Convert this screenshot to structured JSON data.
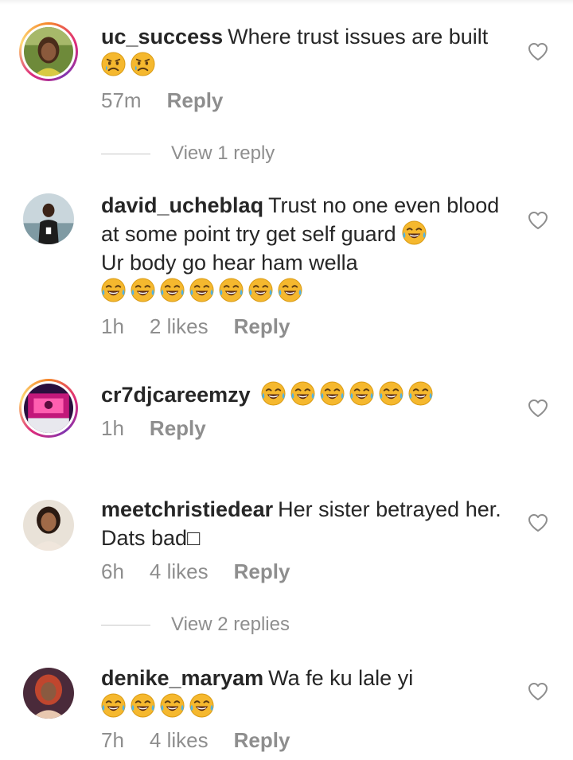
{
  "comments": [
    {
      "username": "uc_success",
      "text": "Where trust issues are built",
      "emojis": [
        "worried",
        "worried"
      ],
      "time": "57m",
      "likes": "",
      "reply_label": "Reply",
      "avatar_ring": true,
      "view_replies": "View 1 reply"
    },
    {
      "username": "david_ucheblaq",
      "text": "Trust no one even blood at some point try get self guard",
      "text_emoji_inline": "tears-of-joy",
      "text_line2": "Ur body go hear ham wella",
      "emojis": [
        "tears-of-joy",
        "tears-of-joy",
        "tears-of-joy",
        "tears-of-joy",
        "tears-of-joy",
        "tears-of-joy",
        "tears-of-joy"
      ],
      "time": "1h",
      "likes": "2 likes",
      "reply_label": "Reply",
      "avatar_ring": false
    },
    {
      "username": "cr7djcareemzy",
      "text": "",
      "emojis": [
        "tears-of-joy",
        "tears-of-joy",
        "tears-of-joy",
        "tears-of-joy",
        "tears-of-joy",
        "tears-of-joy"
      ],
      "time": "1h",
      "likes": "",
      "reply_label": "Reply",
      "avatar_ring": true
    },
    {
      "username": "meetchristiedear",
      "text": "Her sister betrayed her. Dats bad",
      "trailing_glyph": "□",
      "time": "6h",
      "likes": "4 likes",
      "reply_label": "Reply",
      "avatar_ring": false,
      "view_replies": "View 2 replies"
    },
    {
      "username": "denike_maryam",
      "text": "Wa fe ku lale yi",
      "emojis": [
        "tears-of-joy",
        "tears-of-joy",
        "tears-of-joy",
        "tears-of-joy"
      ],
      "time": "7h",
      "likes": "4 likes",
      "reply_label": "Reply",
      "avatar_ring": false
    }
  ],
  "icons": {
    "like": "heart-outline-icon",
    "worried": "worried-face-emoji",
    "tears_of_joy": "face-with-tears-of-joy-emoji"
  },
  "colors": {
    "text": "#262626",
    "meta": "#8e8e8e",
    "ring_start": "#f58529",
    "ring_mid": "#dd2a7b",
    "ring_end": "#8134af"
  }
}
